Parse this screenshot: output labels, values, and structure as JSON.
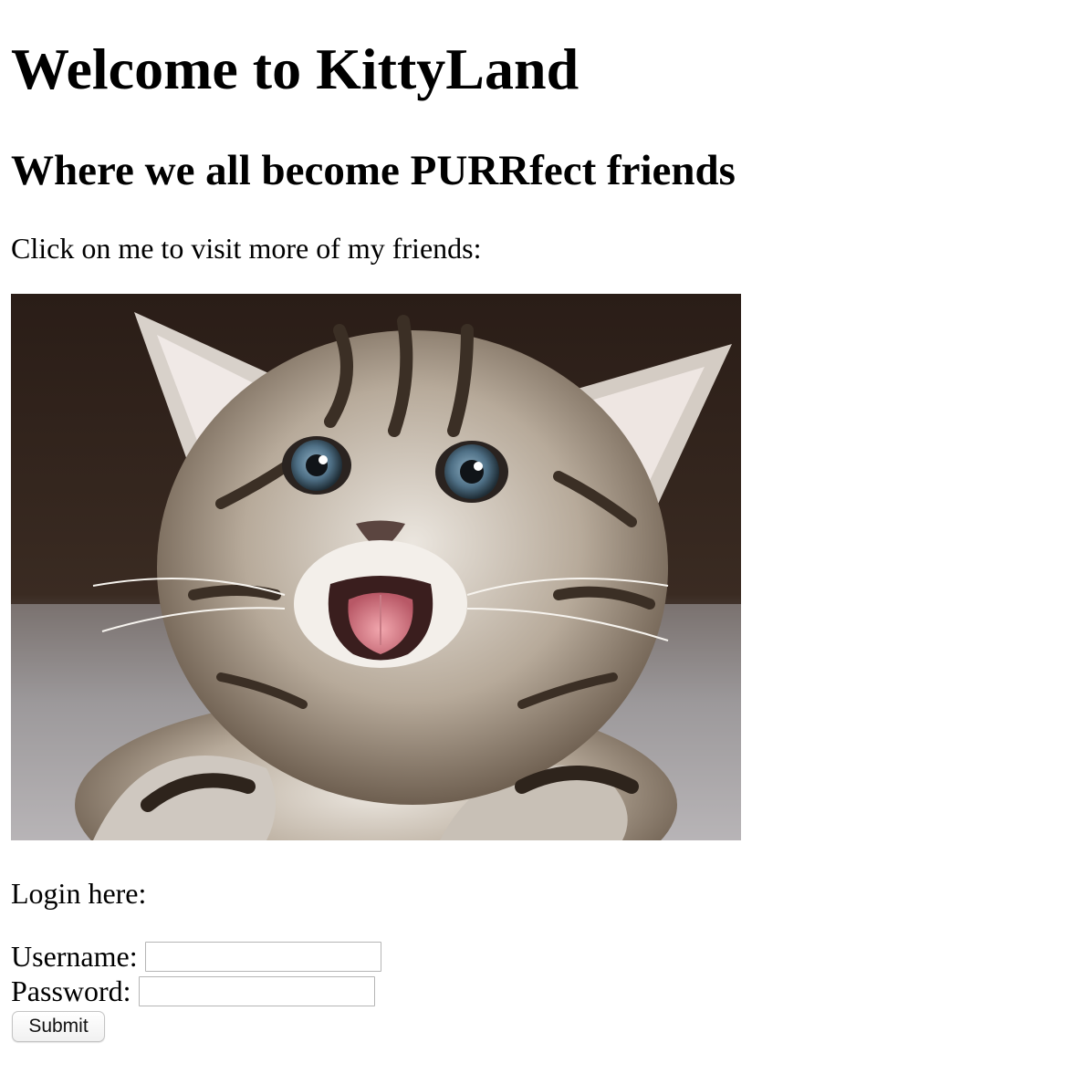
{
  "page": {
    "heading": "Welcome to KittyLand",
    "subheading": "Where we all become PURRfect friends",
    "intro_text": "Click on me to visit more of my friends:"
  },
  "kitten_image": {
    "subject": "kitten",
    "alt": ""
  },
  "login": {
    "label": "Login here:",
    "username_label": "Username:",
    "username_value": "",
    "password_label": "Password:",
    "password_value": "",
    "submit_label": "Submit"
  },
  "colors": {
    "background": "#ffffff",
    "text": "#000000",
    "input_border": "#b5b5b5"
  }
}
